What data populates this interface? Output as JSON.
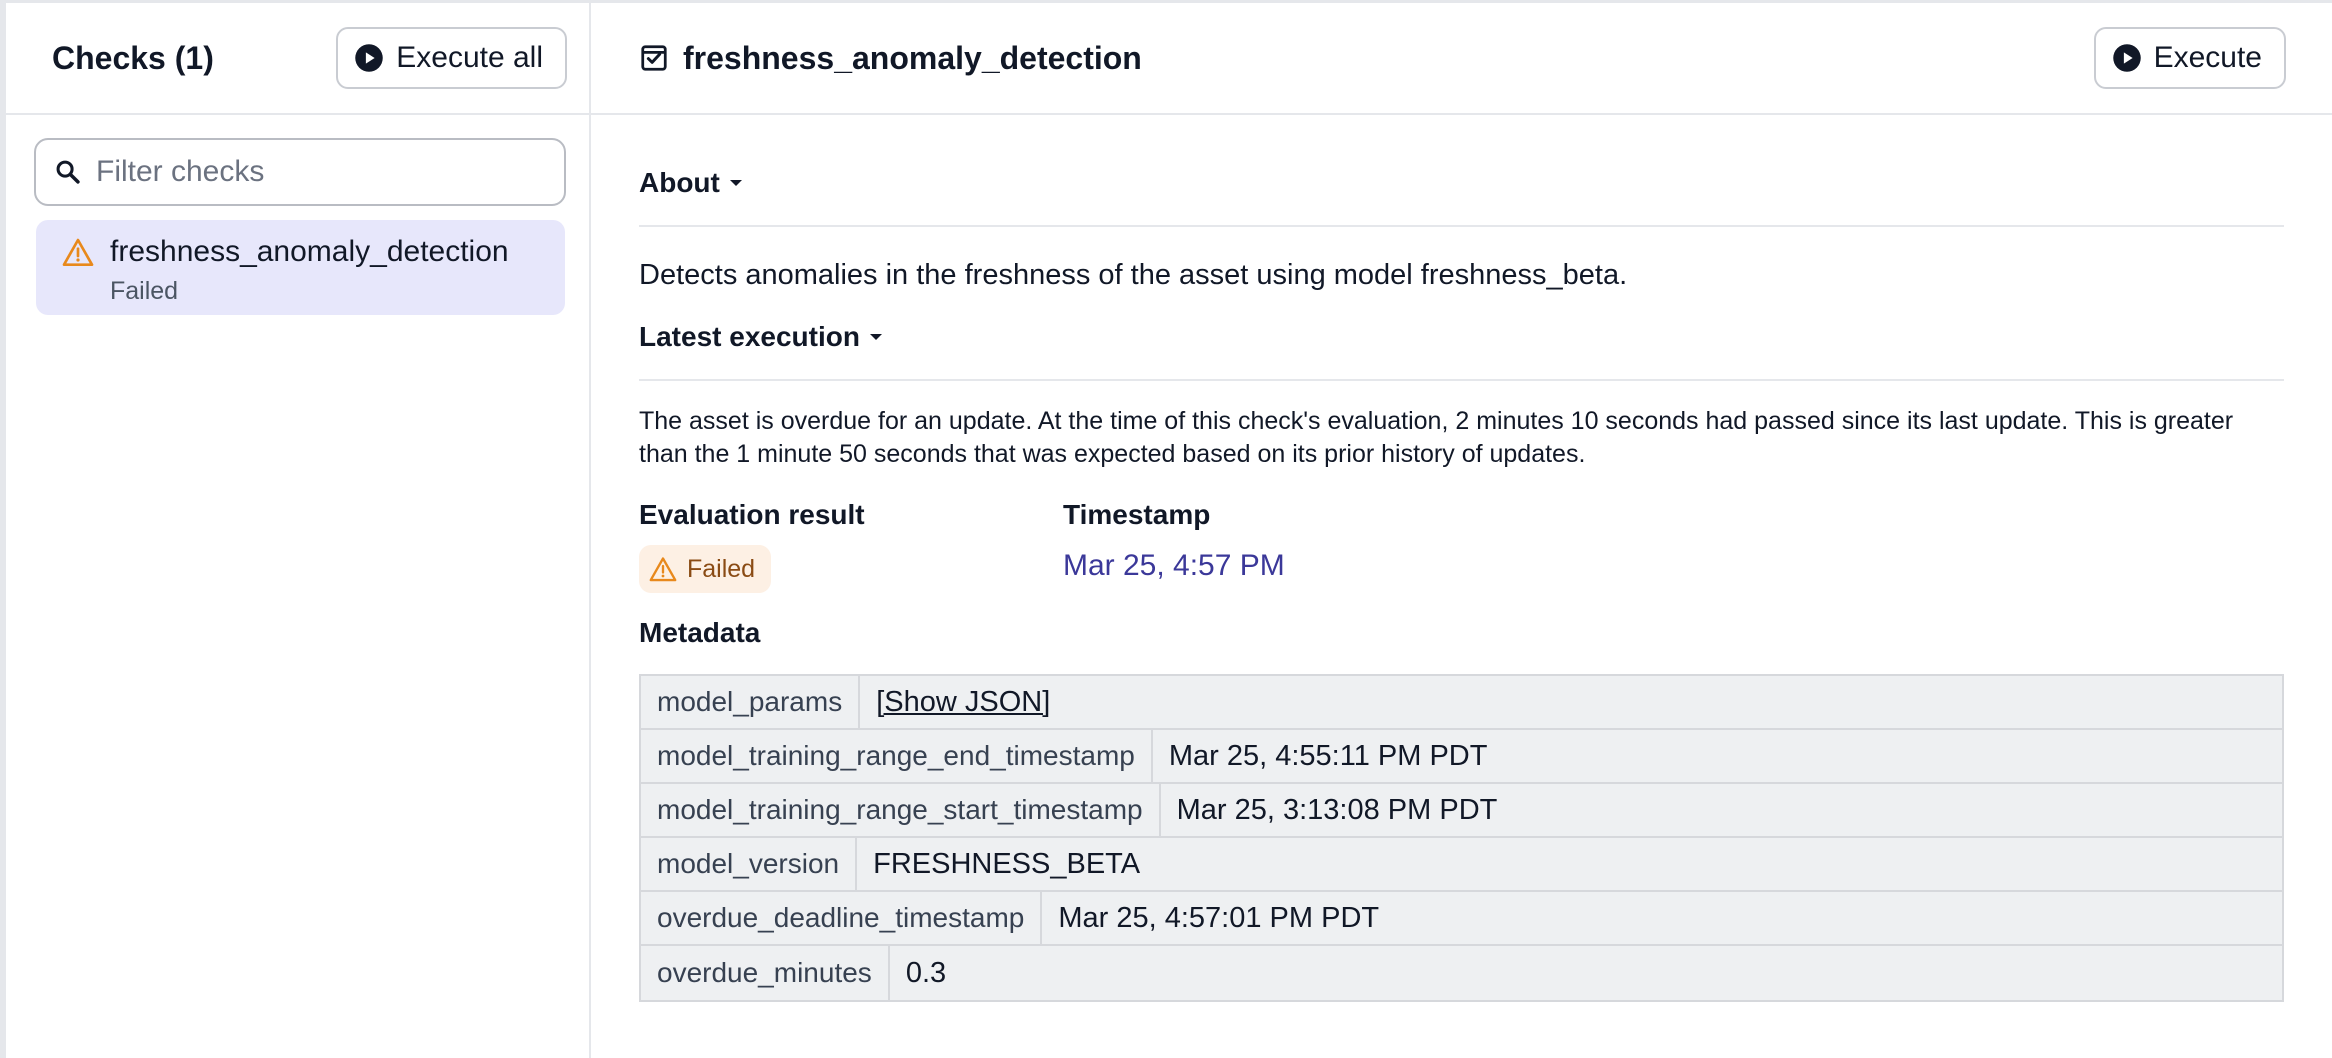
{
  "sidebar": {
    "title": "Checks (1)",
    "execute_all_label": "Execute all",
    "search": {
      "placeholder": "Filter checks",
      "value": ""
    },
    "items": [
      {
        "name": "freshness_anomaly_detection",
        "status": "Failed",
        "selected": true
      }
    ]
  },
  "main": {
    "title": "freshness_anomaly_detection",
    "execute_label": "Execute",
    "about": {
      "heading": "About",
      "text": "Detects anomalies in the freshness of the asset using model freshness_beta."
    },
    "latest_execution": {
      "heading": "Latest execution",
      "description": "The asset is overdue for an update. At the time of this check's evaluation, 2 minutes 10 seconds had passed since its last update. This is greater than the 1 minute 50 seconds that was expected based on its prior history of updates.",
      "evaluation_label": "Evaluation result",
      "evaluation_value": "Failed",
      "timestamp_label": "Timestamp",
      "timestamp_value": "Mar 25, 4:57 PM"
    },
    "metadata": {
      "heading": "Metadata",
      "rows": [
        {
          "key": "model_params",
          "value": "[Show JSON]"
        },
        {
          "key": "model_training_range_end_timestamp",
          "value": "Mar 25, 4:55:11 PM PDT"
        },
        {
          "key": "model_training_range_start_timestamp",
          "value": "Mar 25, 3:13:08 PM PDT"
        },
        {
          "key": "model_version",
          "value": "FRESHNESS_BETA"
        },
        {
          "key": "overdue_deadline_timestamp",
          "value": "Mar 25, 4:57:01 PM PDT"
        },
        {
          "key": "overdue_minutes",
          "value": "0.3"
        }
      ]
    }
  },
  "colors": {
    "selected_item_bg": "#e7e7fb",
    "warning": "#e8891c",
    "failed_badge_bg": "#fdf0e4",
    "link": "#3b3899"
  }
}
